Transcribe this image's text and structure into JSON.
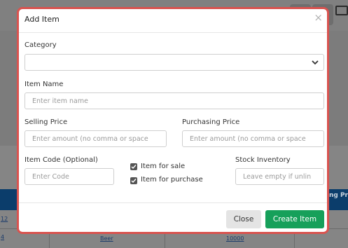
{
  "modal": {
    "title": "Add Item",
    "close_symbol": "×",
    "category": {
      "label": "Category",
      "value": ""
    },
    "item_name": {
      "label": "Item Name",
      "placeholder": "Enter item name"
    },
    "selling_price": {
      "label": "Selling Price",
      "placeholder": "Enter amount (no comma or space"
    },
    "purchasing_price": {
      "label": "Purchasing Price",
      "placeholder": "Enter amount (no comma or space"
    },
    "item_code": {
      "label": "Item Code (Optional)",
      "placeholder": "Enter Code"
    },
    "checkboxes": [
      {
        "label": "Item for sale",
        "checked": true
      },
      {
        "label": "Item for purchase",
        "checked": true
      }
    ],
    "stock_inventory": {
      "label": "Stock Inventory",
      "placeholder": "Leave empty if unlin"
    },
    "buttons": {
      "close": "Close",
      "create": "Create Item"
    }
  },
  "background": {
    "table_header_right": "ng Pr",
    "row_texts": [
      "12",
      "4",
      "Beer",
      "10000"
    ]
  },
  "colors": {
    "modal_border": "#d9534f",
    "create_button": "#16a05a",
    "table_header": "#0b3d6b"
  }
}
